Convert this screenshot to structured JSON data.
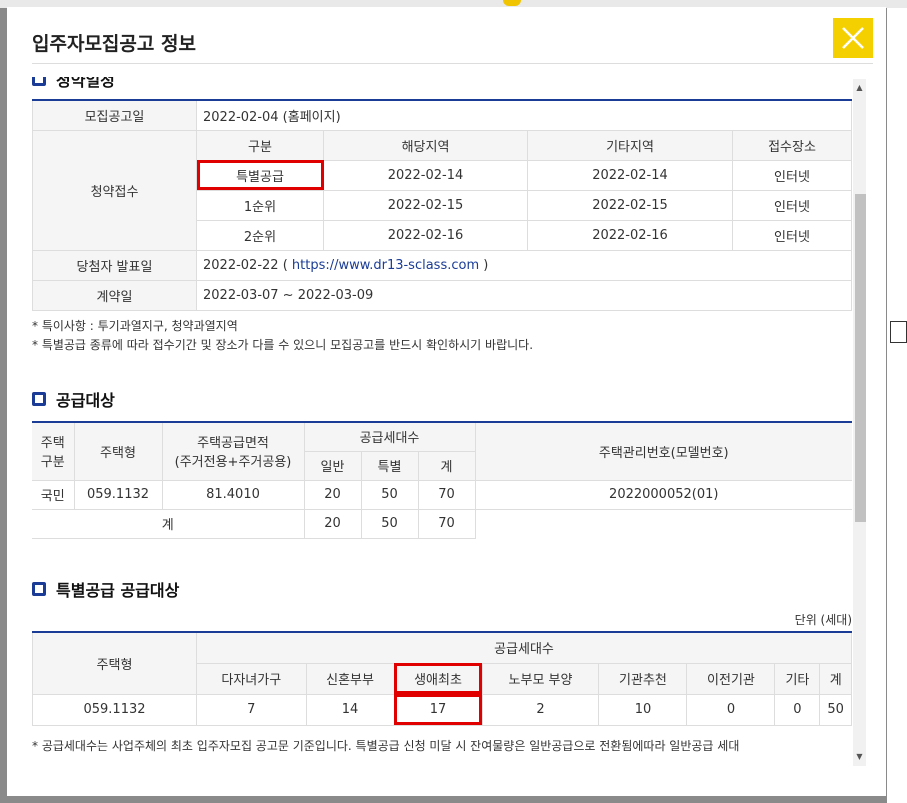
{
  "modal": {
    "title": "입주자모집공고 정보"
  },
  "schedule": {
    "section_title": "청약일정",
    "announce_label": "모집공고일",
    "announce_value": "2022-02-04 (홈페이지)",
    "receipt_label": "청약접수",
    "columns": [
      "구분",
      "해당지역",
      "기타지역",
      "접수장소"
    ],
    "rows": [
      [
        "특별공급",
        "2022-02-14",
        "2022-02-14",
        "인터넷"
      ],
      [
        "1순위",
        "2022-02-15",
        "2022-02-15",
        "인터넷"
      ],
      [
        "2순위",
        "2022-02-16",
        "2022-02-16",
        "인터넷"
      ]
    ],
    "winner_label": "당첨자 발표일",
    "winner_date": "2022-02-22",
    "winner_paren_open": "(",
    "winner_link": "https://www.dr13-sclass.com",
    "winner_paren_close": ")",
    "contract_label": "계약일",
    "contract_value": "2022-03-07 ~ 2022-03-09"
  },
  "notes": [
    "* 특이사항 : 투기과열지구, 청약과열지역",
    "* 특별공급 종류에 따라 접수기간 및 장소가 다를 수 있으니 모집공고를 반드시 확인하시기 바랍니다."
  ],
  "supply": {
    "section_title": "공급대상",
    "h_kind": "주택구분",
    "h_kind_1": "주택",
    "h_kind_2": "구분",
    "h_type": "주택형",
    "h_area_1": "주택공급면적",
    "h_area_2": "(주거전용+주거공용)",
    "h_units": "공급세대수",
    "h_general": "일반",
    "h_special": "특별",
    "h_total": "계",
    "h_model": "주택관리번호(모델번호)",
    "row": {
      "kind": "국민",
      "type": "059.1132",
      "area": "81.4010",
      "general": "20",
      "special": "50",
      "total": "70",
      "model": "2022000052(01)"
    },
    "sum": {
      "label": "계",
      "general": "20",
      "special": "50",
      "total": "70"
    }
  },
  "special": {
    "section_title": "특별공급 공급대상",
    "unit": "단위 (세대)",
    "h_type": "주택형",
    "h_units": "공급세대수",
    "columns": [
      "다자녀가구",
      "신혼부부",
      "생애최초",
      "노부모 부양",
      "기관추천",
      "이전기관",
      "기타",
      "계"
    ],
    "row": {
      "type": "059.1132",
      "values": [
        "7",
        "14",
        "17",
        "2",
        "10",
        "0",
        "0",
        "50"
      ]
    }
  },
  "footnote": "* 공급세대수는 사업주체의 최초 입주자모집 공고문 기준입니다. 특별공급 신청 미달 시 잔여물량은 일반공급으로 전환됨에따라 일반공급 세대",
  "colors": {
    "accent": "#1a3c96",
    "close": "#f5d000",
    "highlight": "#e00000"
  }
}
